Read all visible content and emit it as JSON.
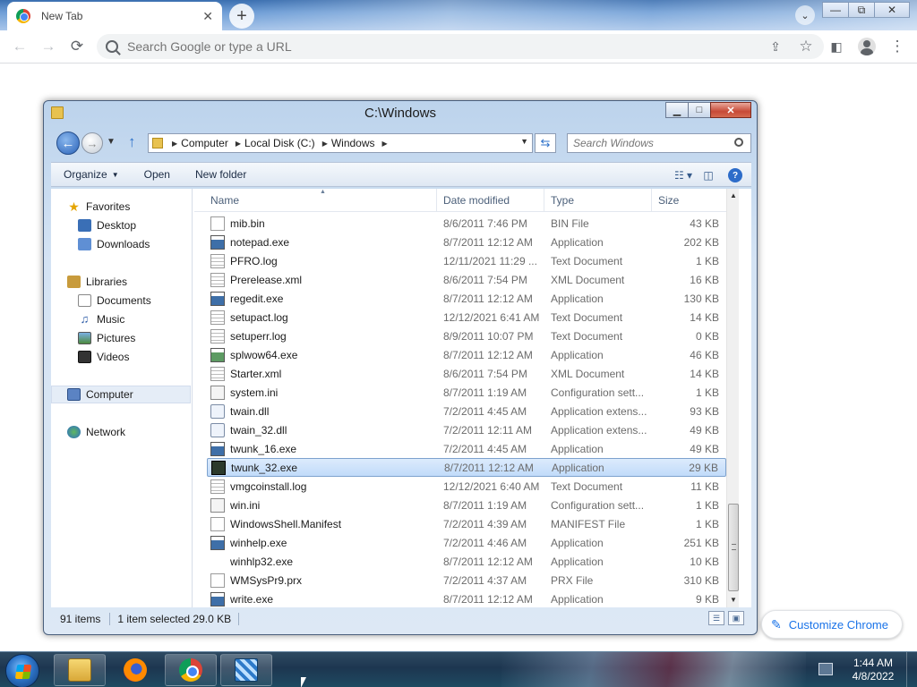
{
  "chrome": {
    "tab_title": "New Tab",
    "tab_close": "✕",
    "new_tab": "+",
    "tab_search": "⌄",
    "omnibox_placeholder": "Search Google or type a URL",
    "customize_label": "Customize Chrome",
    "window_min": "—",
    "window_max": "⧉",
    "window_close": "✕"
  },
  "explorer": {
    "title": "C:\\Windows",
    "breadcrumb": [
      "Computer",
      "Local Disk (C:)",
      "Windows"
    ],
    "search_placeholder": "Search Windows",
    "commands": {
      "organize": "Organize",
      "open": "Open",
      "new_folder": "New folder"
    },
    "nav": {
      "favorites": "Favorites",
      "desktop": "Desktop",
      "downloads": "Downloads",
      "libraries": "Libraries",
      "documents": "Documents",
      "music": "Music",
      "pictures": "Pictures",
      "videos": "Videos",
      "computer": "Computer",
      "network": "Network"
    },
    "columns": {
      "name": "Name",
      "date": "Date modified",
      "type": "Type",
      "size": "Size"
    },
    "files": [
      {
        "name": "mib.bin",
        "date": "8/6/2011 7:46 PM",
        "type": "BIN File",
        "size": "43 KB",
        "icon": "file"
      },
      {
        "name": "notepad.exe",
        "date": "8/7/2011 12:12 AM",
        "type": "Application",
        "size": "202 KB",
        "icon": "exe"
      },
      {
        "name": "PFRO.log",
        "date": "12/11/2021 11:29 ...",
        "type": "Text Document",
        "size": "1 KB",
        "icon": "log"
      },
      {
        "name": "Prerelease.xml",
        "date": "8/6/2011 7:54 PM",
        "type": "XML Document",
        "size": "16 KB",
        "icon": "log"
      },
      {
        "name": "regedit.exe",
        "date": "8/7/2011 12:12 AM",
        "type": "Application",
        "size": "130 KB",
        "icon": "exe"
      },
      {
        "name": "setupact.log",
        "date": "12/12/2021 6:41 AM",
        "type": "Text Document",
        "size": "14 KB",
        "icon": "log"
      },
      {
        "name": "setuperr.log",
        "date": "8/9/2011 10:07 PM",
        "type": "Text Document",
        "size": "0 KB",
        "icon": "log"
      },
      {
        "name": "splwow64.exe",
        "date": "8/7/2011 12:12 AM",
        "type": "Application",
        "size": "46 KB",
        "icon": "exeg"
      },
      {
        "name": "Starter.xml",
        "date": "8/6/2011 7:54 PM",
        "type": "XML Document",
        "size": "14 KB",
        "icon": "log"
      },
      {
        "name": "system.ini",
        "date": "8/7/2011 1:19 AM",
        "type": "Configuration sett...",
        "size": "1 KB",
        "icon": "ini"
      },
      {
        "name": "twain.dll",
        "date": "7/2/2011 4:45 AM",
        "type": "Application extens...",
        "size": "93 KB",
        "icon": "dll"
      },
      {
        "name": "twain_32.dll",
        "date": "7/2/2011 12:11 AM",
        "type": "Application extens...",
        "size": "49 KB",
        "icon": "dll"
      },
      {
        "name": "twunk_16.exe",
        "date": "7/2/2011 4:45 AM",
        "type": "Application",
        "size": "49 KB",
        "icon": "exe"
      },
      {
        "name": "twunk_32.exe",
        "date": "8/7/2011 12:12 AM",
        "type": "Application",
        "size": "29 KB",
        "icon": "twunk",
        "selected": true
      },
      {
        "name": "vmgcoinstall.log",
        "date": "12/12/2021 6:40 AM",
        "type": "Text Document",
        "size": "11 KB",
        "icon": "log"
      },
      {
        "name": "win.ini",
        "date": "8/7/2011 1:19 AM",
        "type": "Configuration sett...",
        "size": "1 KB",
        "icon": "ini"
      },
      {
        "name": "WindowsShell.Manifest",
        "date": "7/2/2011 4:39 AM",
        "type": "MANIFEST File",
        "size": "1 KB",
        "icon": "file"
      },
      {
        "name": "winhelp.exe",
        "date": "7/2/2011 4:46 AM",
        "type": "Application",
        "size": "251 KB",
        "icon": "exe"
      },
      {
        "name": "winhlp32.exe",
        "date": "8/7/2011 12:12 AM",
        "type": "Application",
        "size": "10 KB",
        "icon": "help"
      },
      {
        "name": "WMSysPr9.prx",
        "date": "7/2/2011 4:37 AM",
        "type": "PRX File",
        "size": "310 KB",
        "icon": "file"
      },
      {
        "name": "write.exe",
        "date": "8/7/2011 12:12 AM",
        "type": "Application",
        "size": "9 KB",
        "icon": "exe"
      }
    ],
    "status": {
      "item_count": "91 items",
      "selection": "1 item selected  29.0 KB"
    }
  },
  "taskbar": {
    "time": "1:44 AM",
    "date": "4/8/2022",
    "apps": [
      "file-explorer",
      "firefox",
      "chrome",
      "twunk"
    ]
  },
  "colors": {
    "selection_bg": "#c1dbfa",
    "chrome_accent": "#1a73e8",
    "taskbar_bg": "#1d3650"
  }
}
